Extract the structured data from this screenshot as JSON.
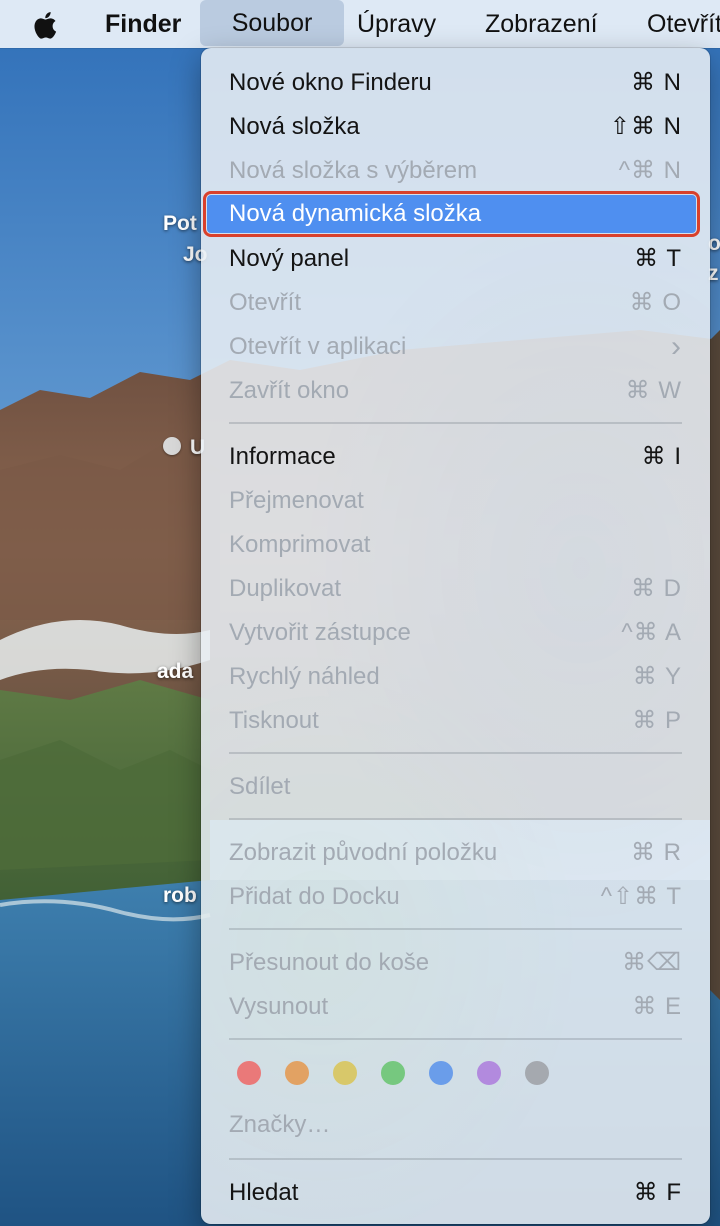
{
  "menubar": {
    "app_name": "Finder",
    "items": [
      "Soubor",
      "Úpravy",
      "Zobrazení",
      "Otevřít"
    ],
    "active": "Soubor"
  },
  "desktop": {
    "labels": [
      "Pot",
      "Jo",
      "ada",
      "rob",
      "U",
      "o",
      "z"
    ]
  },
  "menu": {
    "items": [
      {
        "label": "Nové okno Finderu",
        "shortcut": "⌘ N",
        "enabled": true
      },
      {
        "label": "Nová složka",
        "shortcut": "⇧⌘ N",
        "enabled": true
      },
      {
        "label": "Nová složka s výběrem",
        "shortcut": "^⌘ N",
        "enabled": false
      },
      {
        "label": "Nová dynamická složka",
        "shortcut": "",
        "enabled": true,
        "highlighted": true
      },
      {
        "label": "Nový panel",
        "shortcut": "⌘ T",
        "enabled": true
      },
      {
        "label": "Otevřít",
        "shortcut": "⌘ O",
        "enabled": false
      },
      {
        "label": "Otevřít v aplikaci",
        "shortcut": "›",
        "enabled": false
      },
      {
        "label": "Zavřít okno",
        "shortcut": "⌘ W",
        "enabled": false
      },
      {
        "label": "Informace",
        "shortcut": "⌘ I",
        "enabled": true
      },
      {
        "label": "Přejmenovat",
        "shortcut": "",
        "enabled": false
      },
      {
        "label": "Komprimovat",
        "shortcut": "",
        "enabled": false
      },
      {
        "label": "Duplikovat",
        "shortcut": "⌘ D",
        "enabled": false
      },
      {
        "label": "Vytvořit zástupce",
        "shortcut": "^⌘ A",
        "enabled": false
      },
      {
        "label": "Rychlý náhled",
        "shortcut": "⌘ Y",
        "enabled": false
      },
      {
        "label": "Tisknout",
        "shortcut": "⌘ P",
        "enabled": false
      },
      {
        "label": "Sdílet",
        "shortcut": "",
        "enabled": false
      },
      {
        "label": "Zobrazit původní položku",
        "shortcut": "⌘ R",
        "enabled": false
      },
      {
        "label": "Přidat do Docku",
        "shortcut": "^⇧⌘ T",
        "enabled": false
      },
      {
        "label": "Přesunout do koše",
        "shortcut": "⌘⌫",
        "enabled": false
      },
      {
        "label": "Vysunout",
        "shortcut": "⌘ E",
        "enabled": false
      },
      {
        "label": "Značky…",
        "shortcut": "",
        "enabled": false
      },
      {
        "label": "Hledat",
        "shortcut": "⌘ F",
        "enabled": true
      }
    ],
    "tag_colors": [
      {
        "name": "red",
        "color": "#e88a8a"
      },
      {
        "name": "orange",
        "color": "#e8b27e"
      },
      {
        "name": "yellow",
        "color": "#e6d98a"
      },
      {
        "name": "green",
        "color": "#8fd497"
      },
      {
        "name": "blue",
        "color": "#7fa9ea"
      },
      {
        "name": "purple",
        "color": "#bb9ae0"
      },
      {
        "name": "gray",
        "color": "#b4b8bd"
      }
    ],
    "highlight_color": "#4f8ff0",
    "annotation_color": "#d9412c"
  }
}
